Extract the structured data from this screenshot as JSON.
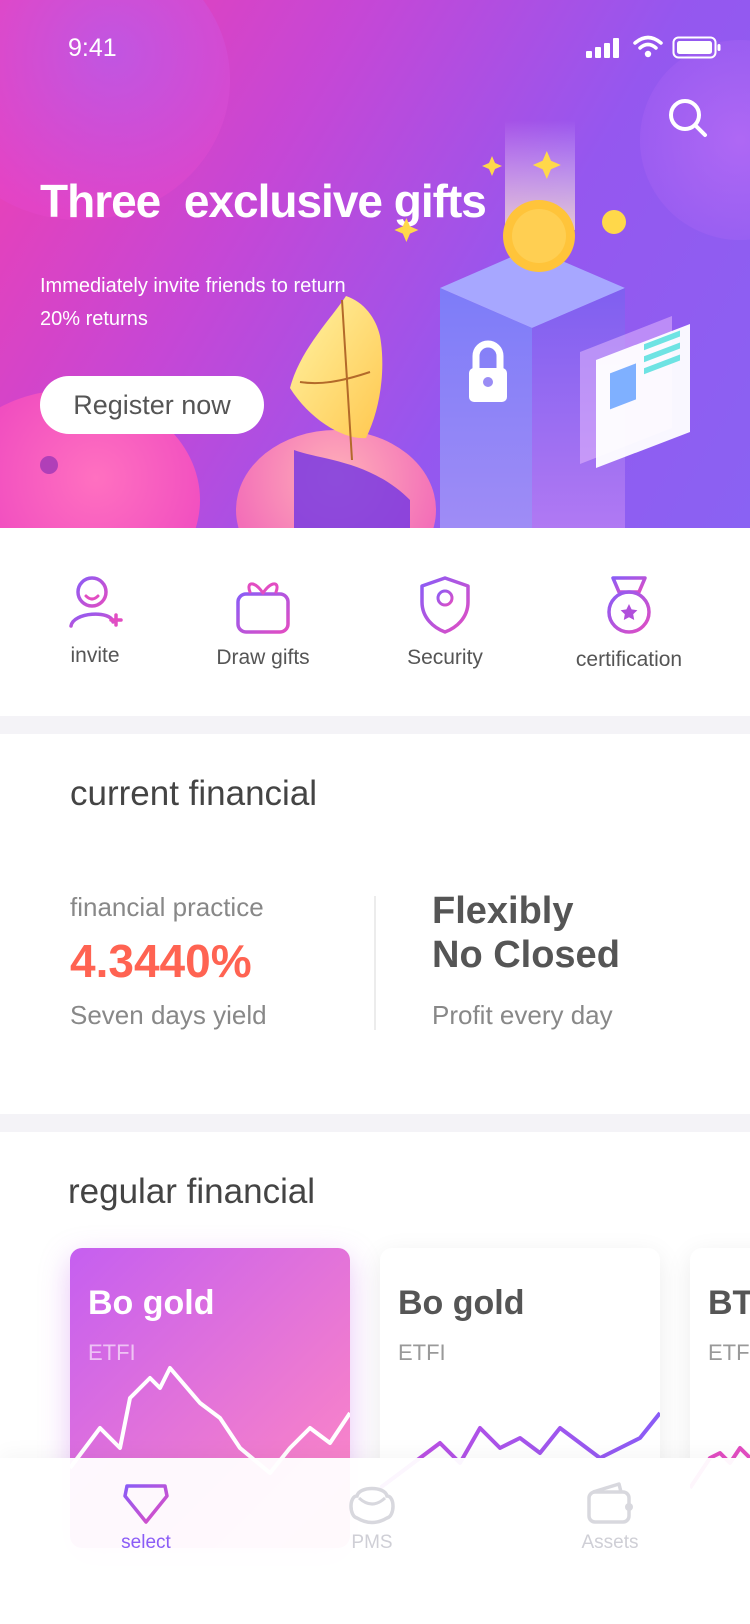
{
  "status_bar": {
    "time": "9:41"
  },
  "hero": {
    "title": "Three  exclusive gifts",
    "subtitle": "Immediately invite friends to return 20% returns",
    "register_label": "Register now"
  },
  "quick_actions": [
    {
      "label": "invite",
      "icon": "invite-user-icon"
    },
    {
      "label": "Draw gifts",
      "icon": "gift-icon"
    },
    {
      "label": "Security",
      "icon": "shield-icon"
    },
    {
      "label": "certification",
      "icon": "medal-icon"
    }
  ],
  "current_financial": {
    "title": "current financial",
    "practice_label": "financial practice",
    "yield_value": "4.3440%",
    "yield_label": "Seven days yield",
    "flex_line1": "Flexibly",
    "flex_line2": "No Closed",
    "profit_label": "Profit every day"
  },
  "regular_financial": {
    "title": "regular financial",
    "cards": [
      {
        "title": "Bo gold",
        "subtitle": "ETFI"
      },
      {
        "title": "Bo gold",
        "subtitle": "ETFI"
      },
      {
        "title": "BT",
        "subtitle": "ETF"
      }
    ]
  },
  "tabbar": {
    "tabs": [
      {
        "label": "select",
        "icon": "diamond-icon",
        "active": true
      },
      {
        "label": "PMS",
        "icon": "ingot-icon",
        "active": false
      },
      {
        "label": "Assets",
        "icon": "wallet-icon",
        "active": false
      }
    ]
  },
  "colors": {
    "accent": "#8a5cf6",
    "yield": "#ff6352",
    "hero_start": "#f23fb0",
    "hero_end": "#8a62f3"
  }
}
